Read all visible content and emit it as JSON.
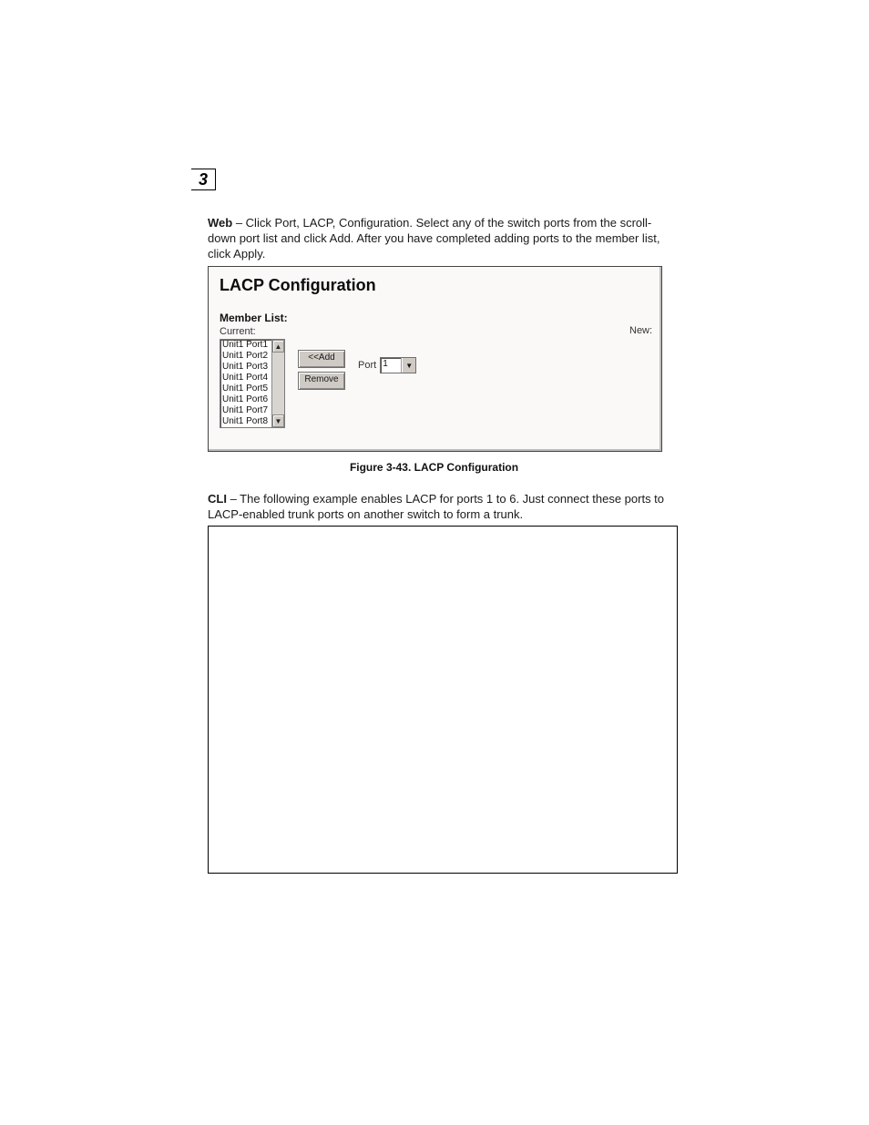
{
  "chapter": {
    "number": "3"
  },
  "web_para": {
    "lead": "Web",
    "text": " – Click Port, LACP, Configuration. Select any of the switch ports from the scroll-down port list and click Add. After you have completed adding ports to the member list, click Apply."
  },
  "figure": {
    "title": "LACP Configuration",
    "member_list_label": "Member List:",
    "current_label": "Current:",
    "new_label": "New:",
    "current_items": [
      "Unit1 Port1",
      "Unit1 Port2",
      "Unit1 Port3",
      "Unit1 Port4",
      "Unit1 Port5",
      "Unit1 Port6",
      "Unit1 Port7",
      "Unit1 Port8"
    ],
    "buttons": {
      "add": "<<Add",
      "remove": "Remove"
    },
    "port": {
      "label": "Port",
      "value": "1"
    },
    "caption": "Figure 3-43.  LACP Configuration"
  },
  "cli_para": {
    "lead": "CLI",
    "text": " – The following example enables LACP for ports 1 to 6. Just connect these ports to LACP-enabled trunk ports on another switch to form a trunk."
  }
}
